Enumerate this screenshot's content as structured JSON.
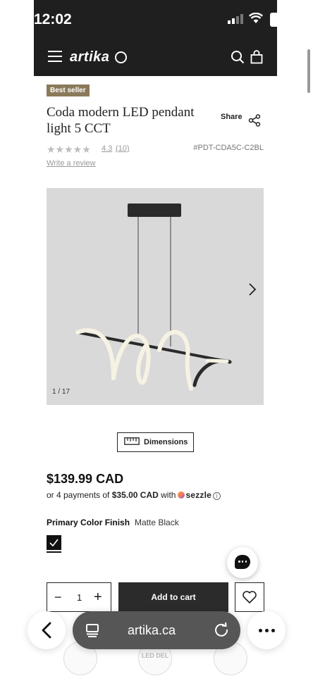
{
  "status_bar": {
    "time": "12:02"
  },
  "nav": {
    "logo": "artika"
  },
  "product": {
    "badge": "Best seller",
    "title": "Coda modern LED pendant light 5 CCT",
    "share_label": "Share",
    "rating_stars": "★★★★★",
    "rating": "4.3",
    "review_count": "(10)",
    "sku": "#PDT-CDA5C-C2BL",
    "write_review": "Write a review",
    "image_counter": "1 / 17",
    "dimensions_label": "Dimensions",
    "price": "$139.99 CAD",
    "installments_prefix": "or 4 payments of",
    "installment_amount": "$35.00 CAD",
    "installments_with": "with",
    "sezzle": "sezzle",
    "finish_label": "Primary Color Finish",
    "finish_value": "Matte Black",
    "quantity": "1",
    "add_to_cart": "Add to cart"
  },
  "thumbnails": [
    {
      "label": ""
    },
    {
      "label": "LED DEL"
    },
    {
      "label": ""
    }
  ],
  "browser": {
    "url": "artika.ca"
  },
  "colors": {
    "nav_bg": "#1f1f1f",
    "badge_bg": "#8a7a5a",
    "add_to_cart_bg": "#2b2b2b",
    "url_bar_bg": "#565656"
  }
}
